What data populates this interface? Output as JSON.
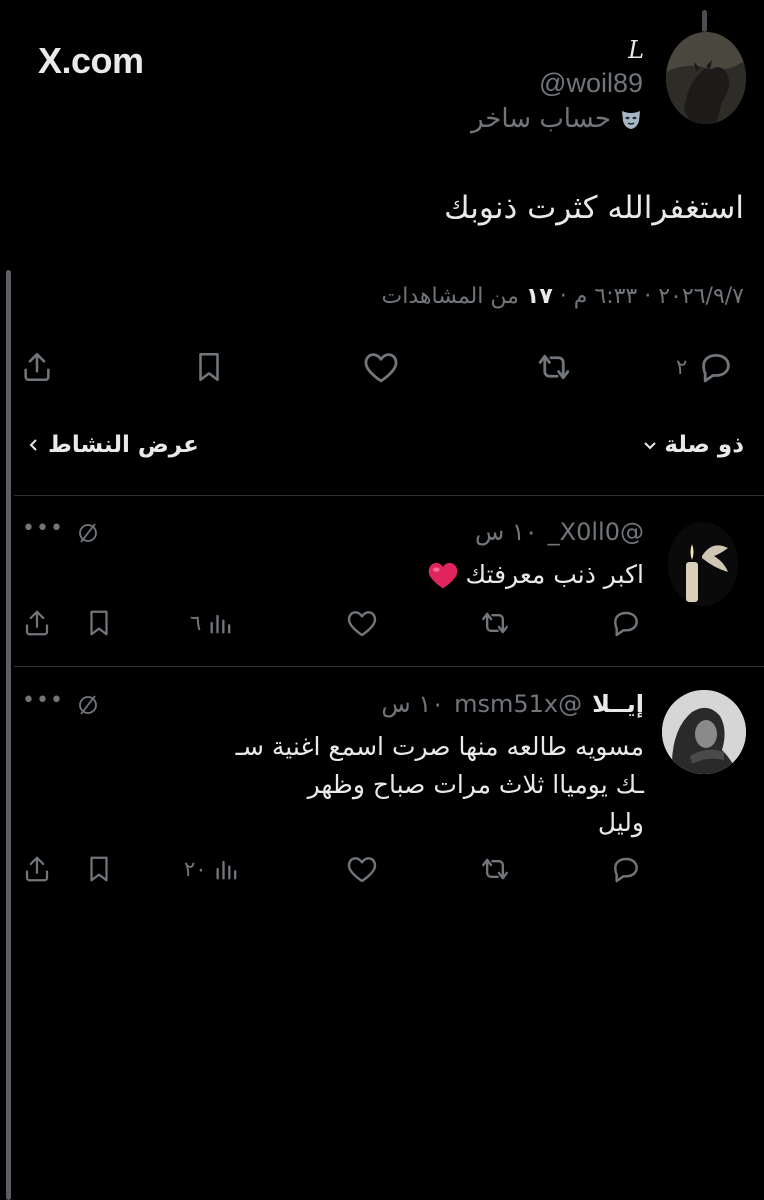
{
  "site": {
    "name": "X.com"
  },
  "tweet": {
    "display_name": "L",
    "handle": "@woil89",
    "bio": "حساب ساخر",
    "bio_icon": "mask-icon",
    "text": "استغفرالله كثرت ذنوبك",
    "time": "٦:٣٣ م",
    "date": "٢٠٢٦/٩/٧",
    "views_count": "١٧",
    "views_label": "من المشاهدات",
    "reply_count": "٢"
  },
  "filter": {
    "sort_label": "ذو صلة",
    "activity_label": "عرض النشاط"
  },
  "replies": [
    {
      "name": "",
      "handle": "@X0ll0_",
      "time": "١٠ س",
      "text": "اكبر ذنب معرفتك",
      "views": "٦"
    },
    {
      "name": "إيــلا",
      "handle": "@msm51x",
      "time": "١٠ س",
      "lines": [
        "مسويه طالعه منها صرت اسمع اغنية سـ",
        "ـك يومياا ثلاث مرات صباح وظهر",
        "وليل"
      ],
      "views": "٢٠"
    }
  ],
  "colors": {
    "background": "#000000",
    "text": "#e7e9ea",
    "muted": "#71767b",
    "divider": "#2f3336",
    "heart": "#e0245e"
  }
}
